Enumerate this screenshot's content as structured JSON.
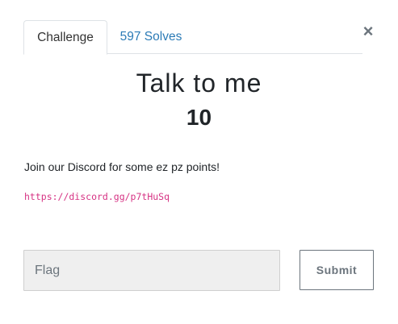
{
  "modal": {
    "close_label": "×",
    "close_icon": "close-icon"
  },
  "tabs": [
    {
      "label": "Challenge",
      "active": true
    },
    {
      "label": "597 Solves",
      "active": false
    }
  ],
  "challenge": {
    "name": "Talk to me",
    "value": "10",
    "description": "Join our Discord for some ez pz points!",
    "link": "https://discord.gg/p7tHuSq"
  },
  "form": {
    "flag_placeholder": "Flag",
    "flag_value": "",
    "submit_label": "Submit"
  },
  "colors": {
    "link": "#2c7bb6",
    "code": "#d63384",
    "input_bg": "#efefef",
    "button_border": "#6c757d"
  }
}
